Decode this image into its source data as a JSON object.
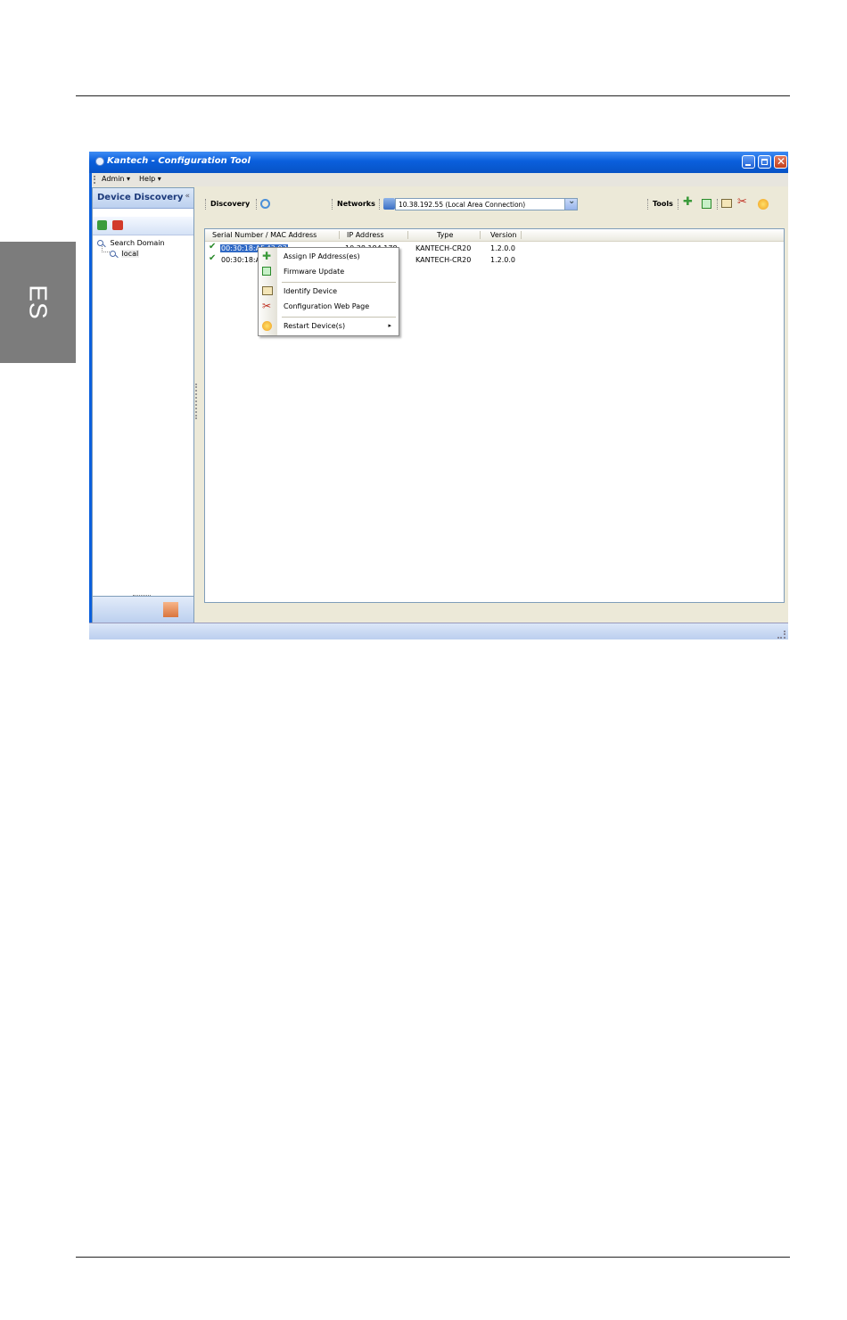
{
  "page": {
    "language_tab": "ES"
  },
  "window": {
    "title": "Kantech - Configuration Tool",
    "menu": [
      "Admin",
      "Help"
    ]
  },
  "left_panel": {
    "header": "Device Discovery",
    "tree": {
      "root": "Search Domain",
      "child": "local"
    }
  },
  "toolbar": {
    "discovery_label": "Discovery",
    "networks_label": "Networks",
    "network_selected": "10.38.192.55 (Local Area Connection)",
    "tools_label": "Tools"
  },
  "list": {
    "columns": [
      "Serial Number / MAC Address",
      "IP Address",
      "Type",
      "Version"
    ],
    "rows": [
      {
        "serial": "00:30:18:AF:42:93",
        "ip": "10.38.184.178",
        "type": "KANTECH-CR20",
        "version": "1.2.0.0"
      },
      {
        "serial": "00:30:18:A",
        "ip": "",
        "type": "KANTECH-CR20",
        "version": "1.2.0.0"
      }
    ]
  },
  "context_menu": {
    "items": [
      "Assign IP Address(es)",
      "Firmware Update",
      "Identify Device",
      "Configuration Web Page",
      "Restart Device(s)"
    ]
  }
}
